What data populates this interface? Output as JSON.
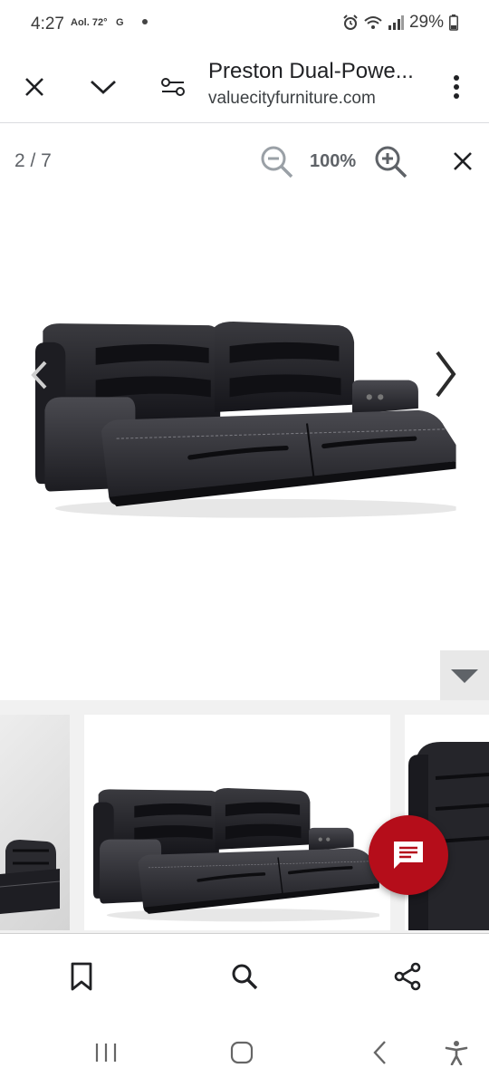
{
  "status_bar": {
    "time": "4:27",
    "weather": "Aol. 72°",
    "carrier_mark": "G",
    "battery_percent": "29%",
    "icons": [
      "alarm-icon",
      "wifi-icon",
      "signal-icon",
      "battery-icon"
    ]
  },
  "header": {
    "title": "Preston Dual-Powe...",
    "url": "valuecityfurniture.com",
    "buttons": [
      "close-icon",
      "chevron-down-icon",
      "filter-icon",
      "more-vert-icon"
    ]
  },
  "viewer": {
    "counter": "2 / 7",
    "zoom": "100%",
    "tools": [
      "zoom-out-icon",
      "zoom-in-icon",
      "close-icon"
    ]
  },
  "image_nav": [
    "chevron-left-icon",
    "chevron-right-icon"
  ],
  "thumbnails": [
    "power-recliner-chair",
    "dual-power-reclining-sofa",
    "reclining-chair"
  ],
  "chat": {
    "icon": "chat-icon",
    "color": "#b50d1a"
  },
  "bottom_actions": [
    "bookmark-icon",
    "search-icon",
    "share-icon"
  ],
  "system_nav": [
    "recent-apps-icon",
    "home-icon",
    "back-icon",
    "accessibility-icon"
  ]
}
